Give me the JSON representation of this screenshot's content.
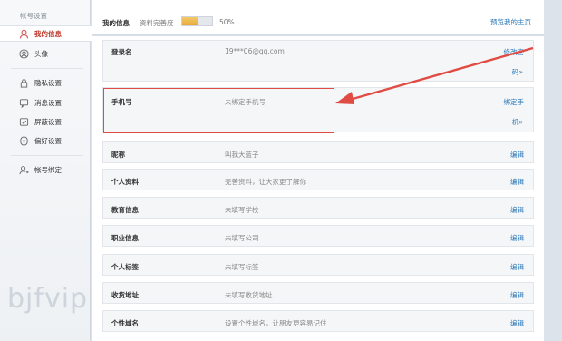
{
  "sidebar": {
    "title": "帐号设置",
    "items": [
      {
        "label": "我的信息",
        "icon": "user-icon",
        "active": true
      },
      {
        "label": "头像",
        "icon": "avatar-icon"
      },
      {
        "label": "隐私设置",
        "icon": "lock-icon"
      },
      {
        "label": "消息设置",
        "icon": "message-icon"
      },
      {
        "label": "屏蔽设置",
        "icon": "block-icon"
      },
      {
        "label": "偏好设置",
        "icon": "preference-icon"
      },
      {
        "label": "帐号绑定",
        "icon": "bind-icon"
      }
    ]
  },
  "header": {
    "title": "我的信息",
    "completion_label": "资料完善度",
    "completion_percent": 50,
    "completion_text": "50%",
    "preview_link": "预览我的主页"
  },
  "rows": [
    {
      "label": "登录名",
      "value": "19***06@qq.com",
      "action_line1": "修改密",
      "action_line2": "码»"
    },
    {
      "label": "手机号",
      "value": "未绑定手机号",
      "action_line1": "绑定手",
      "action_line2": "机»"
    },
    {
      "label": "昵称",
      "value": "叫我大蓝子",
      "action": "编辑"
    },
    {
      "label": "个人资料",
      "value": "完善资料，让大家更了解你",
      "action": "编辑"
    },
    {
      "label": "教育信息",
      "value": "未填写学校",
      "action": "编辑"
    },
    {
      "label": "职业信息",
      "value": "未填写公司",
      "action": "编辑"
    },
    {
      "label": "个人标签",
      "value": "未填写标签",
      "action": "编辑"
    },
    {
      "label": "收货地址",
      "value": "未填写收货地址",
      "action": "编辑"
    },
    {
      "label": "个性域名",
      "value": "设置个性域名，让朋友更容易记住",
      "action": "编辑"
    }
  ],
  "watermark": "bjfvip",
  "colors": {
    "link": "#2a78b8",
    "highlight": "#e04c44",
    "progress": "#e6a93a"
  }
}
